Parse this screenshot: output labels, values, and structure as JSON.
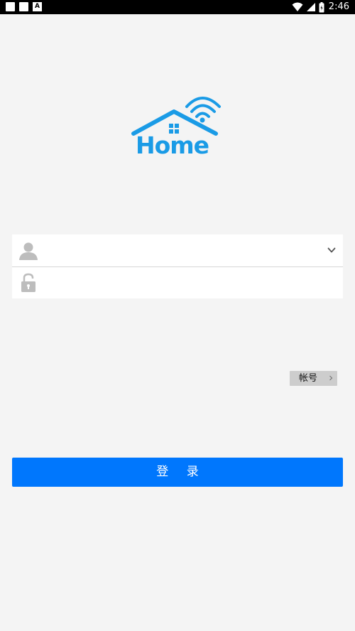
{
  "status_bar": {
    "left_icon_letter": "A",
    "time": "2:46"
  },
  "logo": {
    "text": "Home"
  },
  "form": {
    "username_value": "",
    "password_value": ""
  },
  "account_switch": {
    "label": "帐号"
  },
  "login_button": {
    "label": "登 录"
  },
  "colors": {
    "accent": "#0077fd",
    "logo_blue": "#1a9be6",
    "background": "#f4f4f4"
  },
  "icons": {
    "user": "user-icon",
    "lock": "lock-icon",
    "dropdown": "chevron-down-icon",
    "account_chevron": "chevron-right-icon",
    "wifi": "wifi-icon",
    "signal": "cellular-signal-icon",
    "battery": "battery-icon"
  }
}
